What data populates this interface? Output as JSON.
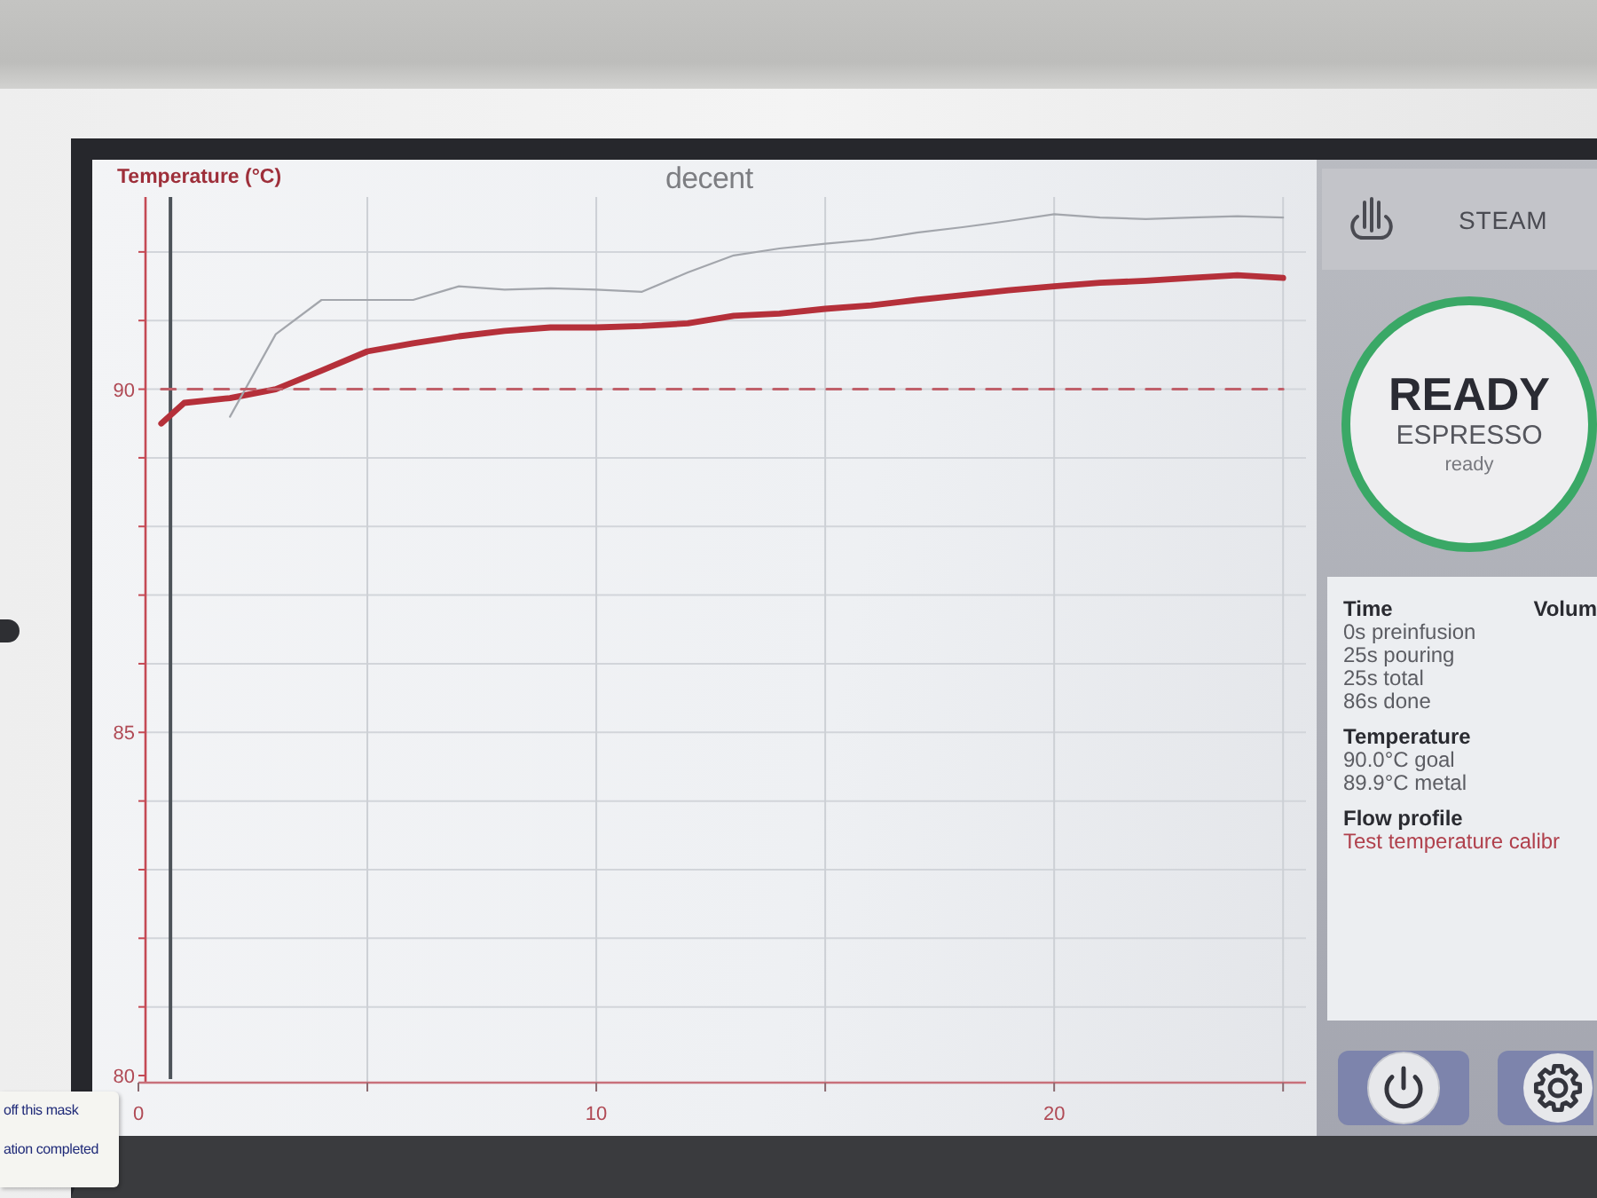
{
  "chart": {
    "logo": "decent",
    "chart_data": {
      "type": "line",
      "ylabel": "Temperature (°C)",
      "x": [
        0.5,
        1,
        2,
        3,
        4,
        5,
        6,
        7,
        8,
        9,
        10,
        11,
        12,
        13,
        14,
        15,
        16,
        17,
        18,
        19,
        20,
        21,
        22,
        23,
        24,
        25
      ],
      "series": [
        {
          "color": "#b5303a",
          "line_style": "solid",
          "values": [
            89.5,
            89.8,
            89.87,
            90.0,
            90.27,
            90.55,
            90.67,
            90.77,
            90.85,
            90.9,
            90.9,
            90.92,
            90.96,
            91.07,
            91.1,
            91.17,
            91.22,
            91.3,
            91.37,
            91.44,
            91.5,
            91.55,
            91.58,
            91.62,
            91.66,
            91.62
          ]
        },
        {
          "color": "#a3a6ac",
          "line_style": "solid",
          "values": [
            null,
            null,
            89.6,
            90.8,
            91.3,
            91.3,
            91.3,
            91.5,
            91.45,
            91.47,
            91.45,
            91.42,
            91.7,
            91.95,
            92.05,
            92.12,
            92.18,
            92.28,
            92.36,
            92.45,
            92.55,
            92.5,
            92.48,
            92.5,
            92.52,
            92.5
          ]
        },
        {
          "color": "#c0606a",
          "line_style": "dashed",
          "values": [
            90,
            90,
            90,
            90,
            90,
            90,
            90,
            90,
            90,
            90,
            90,
            90,
            90,
            90,
            90,
            90,
            90,
            90,
            90,
            90,
            90,
            90,
            90,
            90,
            90,
            90
          ]
        }
      ],
      "ref_lines": [
        {
          "axis": "x",
          "value": 0.7,
          "color": "#4d5359"
        }
      ],
      "xlim": [
        0,
        25.5
      ],
      "ylim": [
        80,
        92.8
      ],
      "xticks": [
        0,
        10,
        20
      ],
      "yticks": [
        80,
        85,
        90
      ],
      "grid": true
    }
  },
  "side_panel": {
    "steam_button": {
      "label": "STEAM"
    },
    "status": {
      "title": "READY",
      "mode": "ESPRESSO",
      "detail": "ready"
    },
    "shot_info": {
      "sections": [
        {
          "heading": "Time",
          "lines": [
            {
              "kind": "stat",
              "text": "0s preinfusion"
            },
            {
              "kind": "stat",
              "text": "25s pouring"
            },
            {
              "kind": "stat",
              "text": "25s total"
            },
            {
              "kind": "stat",
              "text": "86s done"
            }
          ]
        },
        {
          "heading": "Temperature",
          "lines": [
            {
              "kind": "stat",
              "text": "90.0°C goal"
            },
            {
              "kind": "stat",
              "text": "89.9°C metal"
            }
          ]
        },
        {
          "heading": "Flow profile",
          "lines": [
            {
              "kind": "profile",
              "text": "Test temperature calibr"
            }
          ]
        }
      ],
      "column_2": {
        "heading": "Volum"
      }
    }
  },
  "sticker": {
    "lines": [
      "off this mask",
      "ation completed"
    ]
  }
}
